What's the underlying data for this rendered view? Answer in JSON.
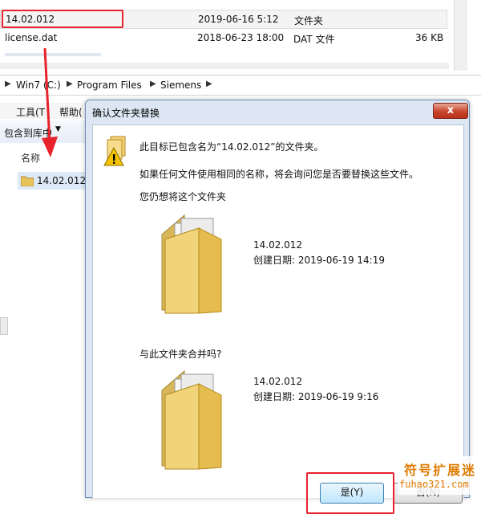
{
  "file_list": {
    "rows": [
      {
        "name": "14.02.012",
        "date": "2019-06-16 5:12",
        "type": "文件夹",
        "size": ""
      },
      {
        "name": "license.dat",
        "date": "2018-06-23 18:00",
        "type": "DAT 文件",
        "size": "36 KB"
      }
    ]
  },
  "address_bar": {
    "crumbs": [
      "Win7 (C:)",
      "Program Files",
      "Siemens"
    ]
  },
  "menu": {
    "tools": "工具(T",
    "help": "帮助("
  },
  "toolbar": {
    "include_in_library": "包含到库中"
  },
  "left_pane": {
    "column_header": "名称",
    "folder_name": "14.02.012"
  },
  "dialog": {
    "title": "确认文件夹替换",
    "close_label": "x",
    "message_line1": "此目标已包含名为“14.02.012”的文件夹。",
    "message_line2": "如果任何文件使用相同的名称，将会询问您是否要替换这些文件。",
    "message_line3": "您仍想将这个文件夹",
    "target": {
      "name": "14.02.012",
      "created": "创建日期: 2019-06-19 14:19"
    },
    "merge_question": "与此文件夹合并吗?",
    "source": {
      "name": "14.02.012",
      "created": "创建日期: 2019-06-19 9:16"
    },
    "yes_label": "是(Y)",
    "no_label": "否(N)"
  },
  "watermark": {
    "title": "符号扩展迷",
    "url": "fuhao321.com"
  },
  "colors": {
    "highlight_red": "#e8222d",
    "dialog_bg": "#dce7f3",
    "watermark": "#e07b00"
  }
}
